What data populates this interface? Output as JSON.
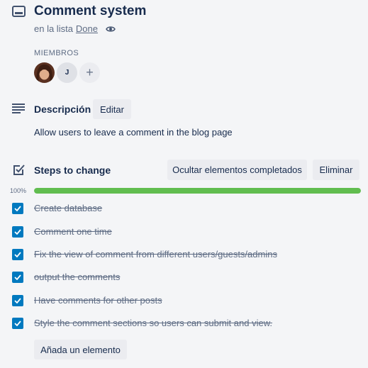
{
  "card": {
    "title": "Comment system",
    "list_prefix": "en la lista",
    "list_name": "Done"
  },
  "members": {
    "label": "MIEMBROS",
    "avatars": [
      {
        "type": "photo"
      },
      {
        "type": "initial",
        "initial": "J"
      }
    ],
    "add_label": "+"
  },
  "description": {
    "heading": "Descripción",
    "edit_label": "Editar",
    "text": "Allow users to leave a comment in the blog page"
  },
  "checklist": {
    "heading": "Steps to change",
    "hide_label": "Ocultar elementos completados",
    "delete_label": "Eliminar",
    "progress_text": "100%",
    "progress_value": 1.0,
    "items": [
      {
        "text": "Create database",
        "checked": true
      },
      {
        "text": "Comment one time",
        "checked": true
      },
      {
        "text": "Fix the view of comment from different users/guests/admins",
        "checked": true
      },
      {
        "text": "output the comments",
        "checked": true
      },
      {
        "text": "Have comments for other posts",
        "checked": true
      },
      {
        "text": "Style the comment sections so users can submit and view.",
        "checked": true
      }
    ],
    "add_item_label": "Añada un elemento"
  },
  "colors": {
    "progress": "#61bd4f",
    "checkbox": "#0079bf",
    "background": "#f4f5f7"
  },
  "icons": {
    "card": "card-icon",
    "watch": "eye-icon",
    "description": "description-icon",
    "checklist": "checklist-icon",
    "check": "check-icon"
  }
}
